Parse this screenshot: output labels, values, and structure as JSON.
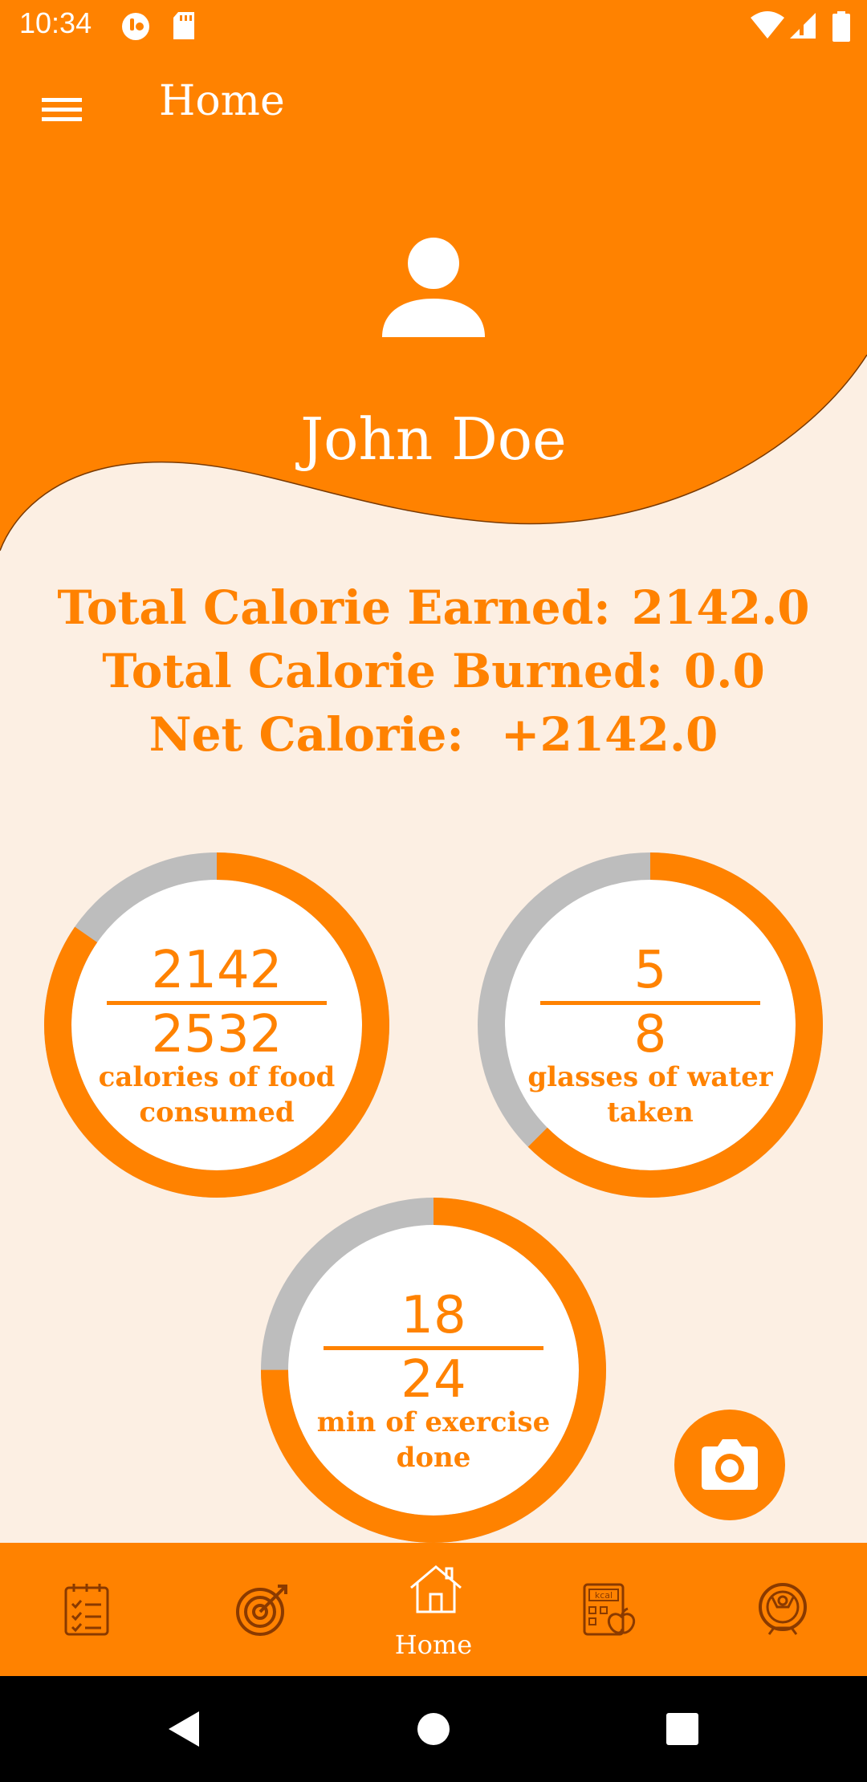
{
  "status_bar": {
    "time": "10:34",
    "icons": [
      "data-saver-icon",
      "sd-card-icon",
      "wifi-icon",
      "signal-icon",
      "battery-icon"
    ]
  },
  "app_bar": {
    "title": "Home",
    "menu_icon": "hamburger-menu-icon"
  },
  "profile": {
    "avatar_icon": "person-icon",
    "name": "John Doe"
  },
  "totals": {
    "earned_label": "Total Calorie Earned:",
    "earned_value": "2142.0",
    "burned_label": "Total Calorie Burned:",
    "burned_value": "0.0",
    "net_label": "Net Calorie:",
    "net_value": "+2142.0"
  },
  "rings": [
    {
      "current": "2142",
      "goal": "2532",
      "caption": "calories of food consumed",
      "progress": 0.846
    },
    {
      "current": "5",
      "goal": "8",
      "caption": "glasses of water taken",
      "progress": 0.625
    },
    {
      "current": "18",
      "goal": "24",
      "caption": "min of exercise done",
      "progress": 0.75
    }
  ],
  "fab": {
    "icon": "camera-icon"
  },
  "bottom_nav": {
    "items": [
      {
        "icon": "checklist-icon",
        "label": ""
      },
      {
        "icon": "target-icon",
        "label": ""
      },
      {
        "icon": "home-icon",
        "label": "Home"
      },
      {
        "icon": "kcal-calculator-icon",
        "label": ""
      },
      {
        "icon": "fitness-icon",
        "label": ""
      }
    ],
    "active_index": 2
  },
  "colors": {
    "accent": "#ff8200",
    "background": "#fcefe3",
    "ring_track": "#bdbdbd",
    "nav_icon": "#8a3a00"
  }
}
